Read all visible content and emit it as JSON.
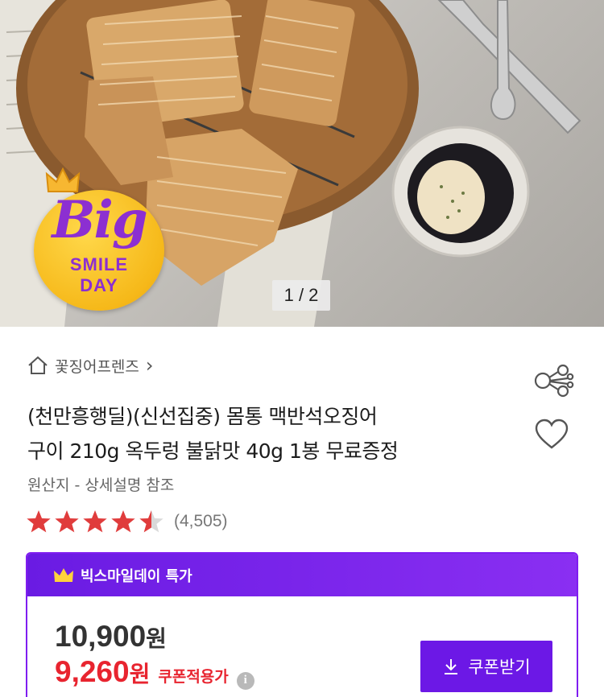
{
  "hero": {
    "badge": {
      "big": "Big",
      "smile": "SMILE",
      "day": "DAY"
    },
    "pager": "1 / 2"
  },
  "breadcrumb": {
    "store": "꽃징어프렌즈",
    "chevron": "›"
  },
  "product": {
    "title_line1": "(천만흥행딜)(신선집중) 몸통 맥반석오징어",
    "title_line2": "구이 210g 옥두렁 불닭맛 40g 1봉 무료증정",
    "origin": "원산지 - 상세설명 참조",
    "rating": 4.5,
    "review_count": "(4,505)"
  },
  "deal": {
    "header": "빅스마일데이 특가",
    "original_price": "10,900",
    "sale_price": "9,260",
    "won": "원",
    "coupon_note": "쿠폰적용가",
    "info_glyph": "i",
    "coupon_button": "쿠폰받기"
  },
  "colors": {
    "accent_purple": "#7f1df0",
    "sale_red": "#e8242f",
    "star_red": "#e03c3c"
  },
  "icons": {
    "home": "home-icon",
    "share": "share-icon",
    "heart": "heart-icon",
    "crown": "crown-icon",
    "download": "download-icon",
    "info": "info-icon"
  }
}
